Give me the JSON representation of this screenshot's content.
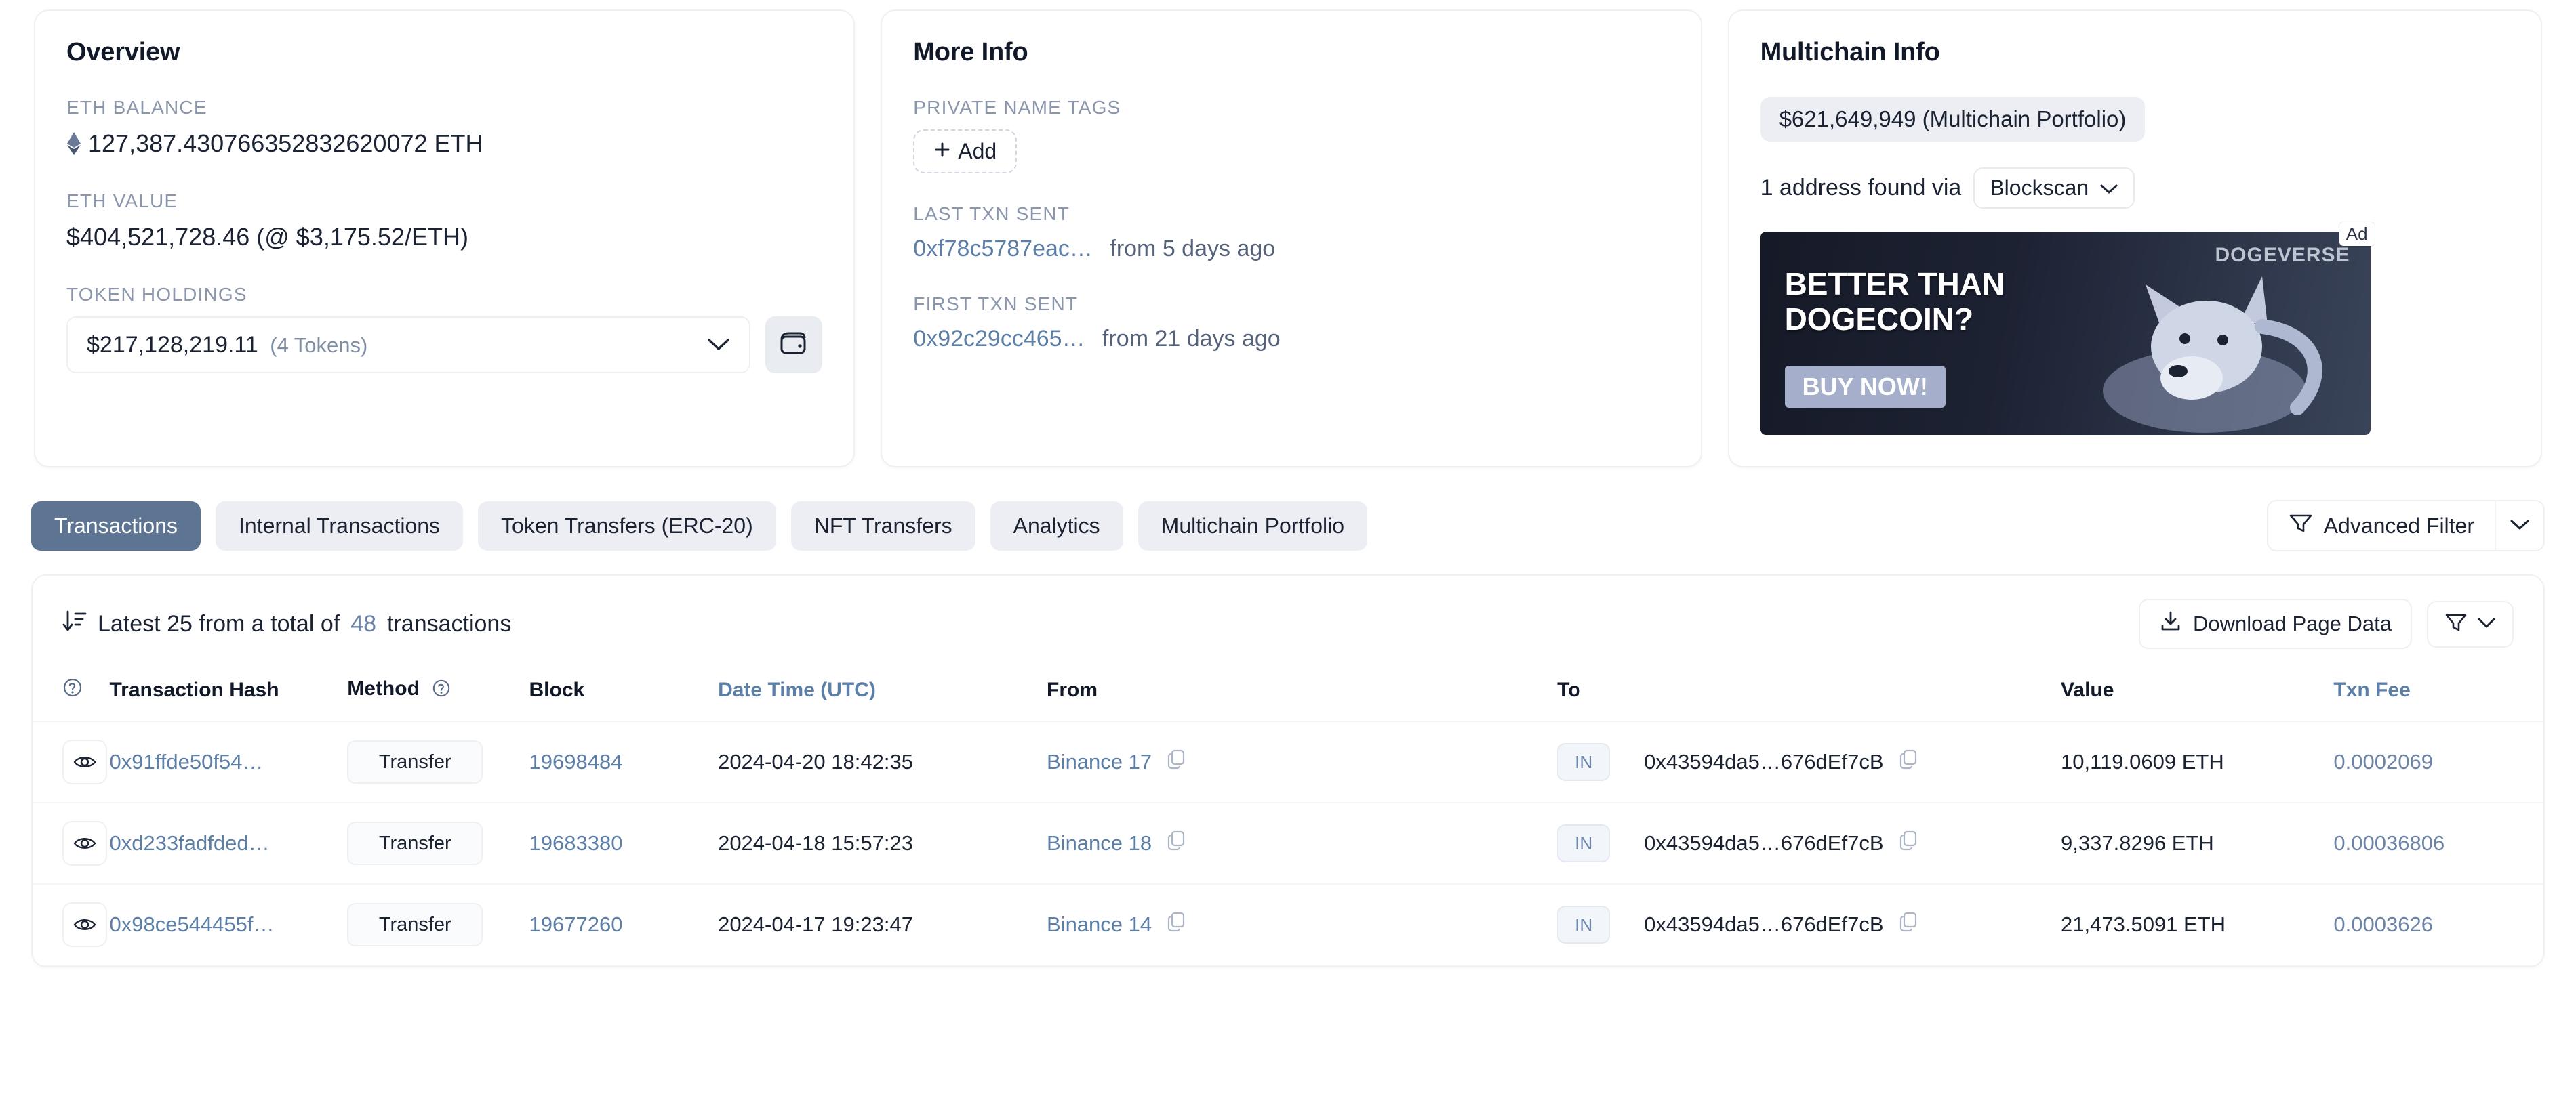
{
  "overview": {
    "title": "Overview",
    "eth_balance_label": "ETH BALANCE",
    "eth_balance": "127,387.430766352832620072 ETH",
    "eth_value_label": "ETH VALUE",
    "eth_value": "$404,521,728.46 (@ $3,175.52/ETH)",
    "token_holdings_label": "TOKEN HOLDINGS",
    "token_holdings_value": "$217,128,219.11",
    "token_holdings_count": "(4 Tokens)"
  },
  "more_info": {
    "title": "More Info",
    "private_name_tags_label": "PRIVATE NAME TAGS",
    "add_label": "Add",
    "last_txn_label": "LAST TXN SENT",
    "last_txn_hash": "0xf78c5787eac…",
    "last_txn_ago": "from 5 days ago",
    "first_txn_label": "FIRST TXN SENT",
    "first_txn_hash": "0x92c29cc465…",
    "first_txn_ago": "from 21 days ago"
  },
  "multichain": {
    "title": "Multichain Info",
    "portfolio": "$621,649,949 (Multichain Portfolio)",
    "addresses_found": "1 address found via",
    "provider": "Blockscan",
    "ad": {
      "tag": "Ad",
      "brand": "DOGEVERSE",
      "headline_line1": "BETTER THAN",
      "headline_line2": "DOGECOIN?",
      "cta": "BUY NOW!"
    }
  },
  "tabs": [
    {
      "label": "Transactions",
      "active": true
    },
    {
      "label": "Internal Transactions",
      "active": false
    },
    {
      "label": "Token Transfers (ERC-20)",
      "active": false
    },
    {
      "label": "NFT Transfers",
      "active": false
    },
    {
      "label": "Analytics",
      "active": false
    },
    {
      "label": "Multichain Portfolio",
      "active": false
    }
  ],
  "advanced_filter_label": "Advanced Filter",
  "table_header": {
    "latest_prefix": "Latest 25 from a total of",
    "total": "48",
    "latest_suffix": "transactions",
    "download_label": "Download Page Data"
  },
  "columns": {
    "eye": "",
    "hash": "Transaction Hash",
    "method": "Method",
    "block": "Block",
    "date": "Date Time (UTC)",
    "from": "From",
    "to": "To",
    "value": "Value",
    "fee": "Txn Fee"
  },
  "rows": [
    {
      "hash": "0x91ffde50f54…",
      "method": "Transfer",
      "block": "19698484",
      "date": "2024-04-20 18:42:35",
      "from": "Binance 17",
      "direction": "IN",
      "to": "0x43594da5…676dEf7cB",
      "value": "10,119.0609 ETH",
      "fee": "0.0002069"
    },
    {
      "hash": "0xd233fadfded…",
      "method": "Transfer",
      "block": "19683380",
      "date": "2024-04-18 15:57:23",
      "from": "Binance 18",
      "direction": "IN",
      "to": "0x43594da5…676dEf7cB",
      "value": "9,337.8296 ETH",
      "fee": "0.00036806"
    },
    {
      "hash": "0x98ce544455f…",
      "method": "Transfer",
      "block": "19677260",
      "date": "2024-04-17 19:23:47",
      "from": "Binance 14",
      "direction": "IN",
      "to": "0x43594da5…676dEf7cB",
      "value": "21,473.5091 ETH",
      "fee": "0.0003626"
    }
  ],
  "colors": {
    "accent": "#5d7592",
    "link": "#5c7fa8",
    "muted": "#8a96ac",
    "border": "#eef0f3"
  }
}
